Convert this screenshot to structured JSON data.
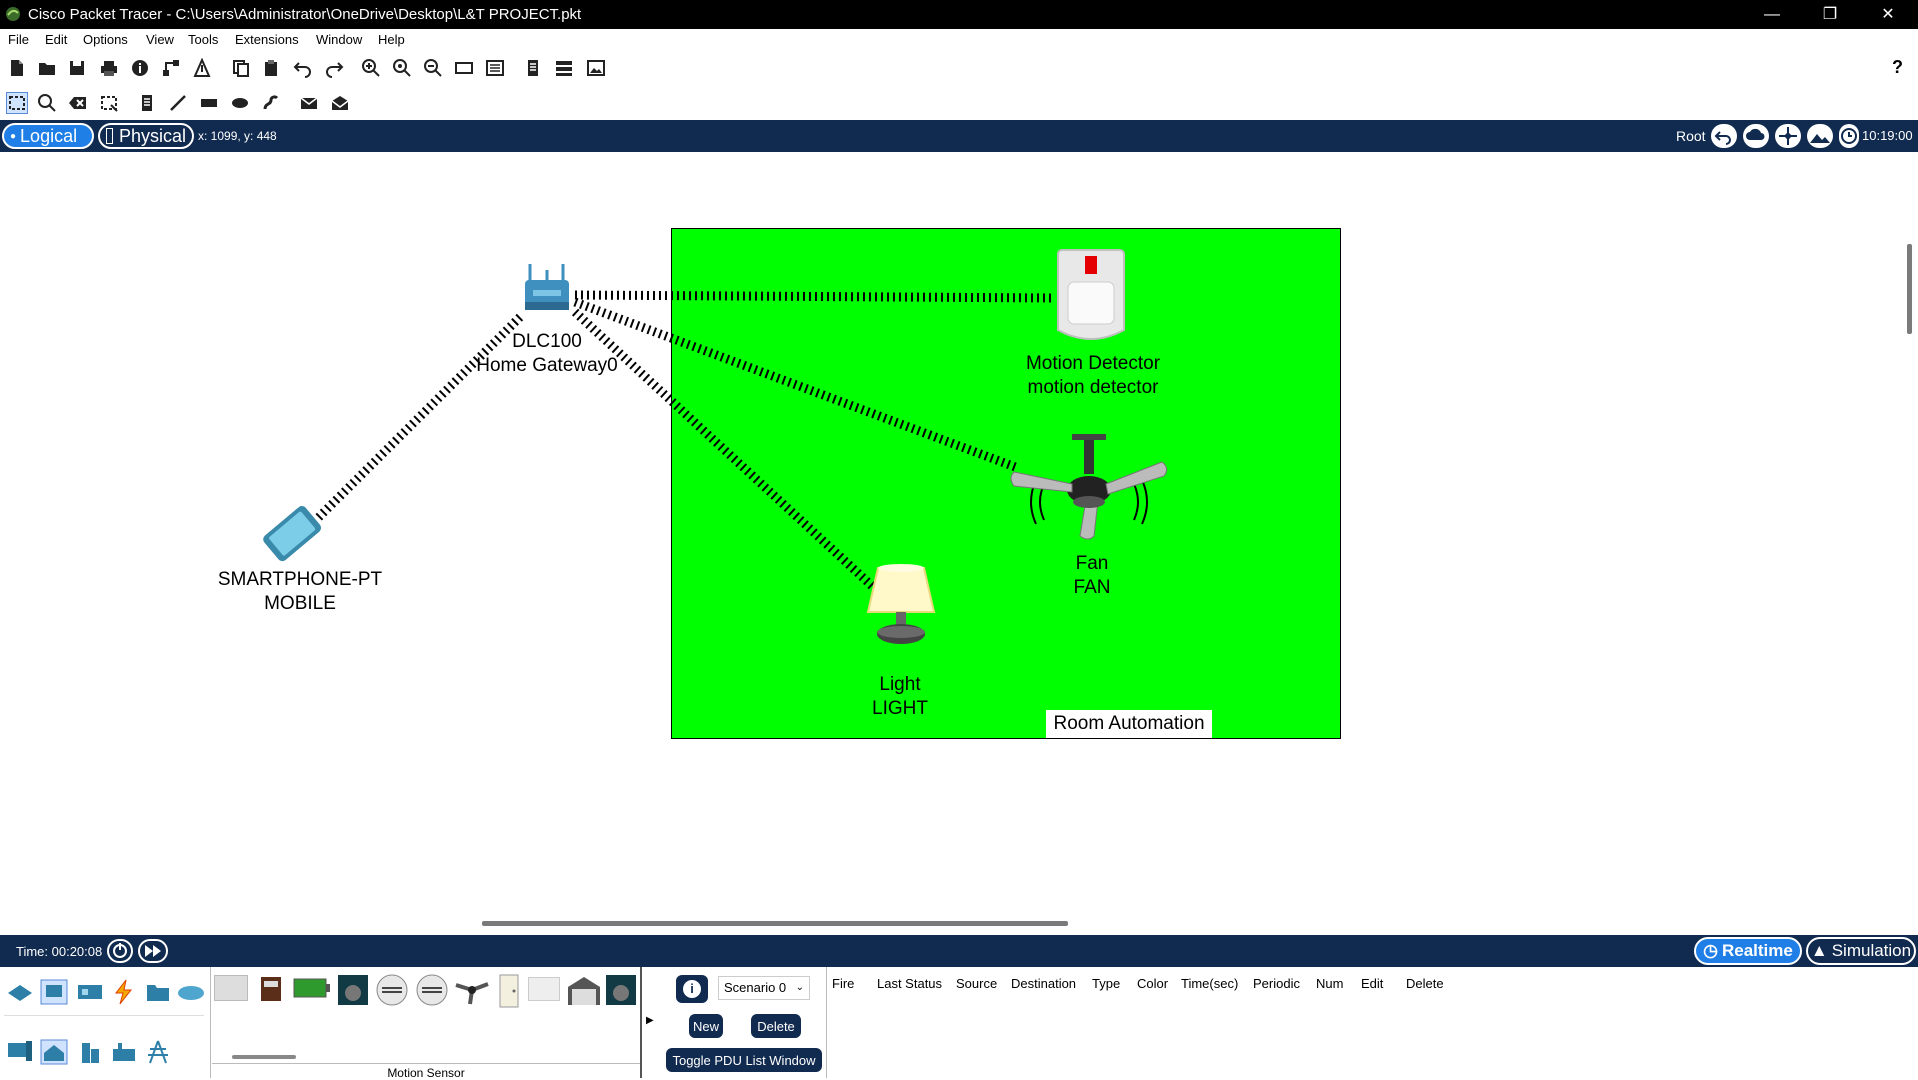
{
  "window": {
    "title": "Cisco Packet Tracer - C:\\Users\\Administrator\\OneDrive\\Desktop\\L&T PROJECT.pkt"
  },
  "menu": [
    "File",
    "Edit",
    "Options",
    "View",
    "Tools",
    "Extensions",
    "Window",
    "Help"
  ],
  "toolbar1_icons": [
    "new-file-icon",
    "open-folder-icon",
    "save-icon",
    "print-icon",
    "info-icon",
    "network-wizard-icon",
    "activity-wizard-icon",
    "copy-icon",
    "paste-icon",
    "undo-icon",
    "redo-icon",
    "zoom-in-icon",
    "zoom-reset-icon",
    "zoom-out-icon",
    "drawing-palette-icon",
    "custom-devices-icon",
    "pdu-list-icon",
    "cluster-icon",
    "image-icon"
  ],
  "toolbar2_icons": [
    "select-icon",
    "inspect-icon",
    "delete-icon",
    "resize-icon",
    "place-note-icon",
    "draw-line-icon",
    "draw-rectangle-icon",
    "draw-ellipse-icon",
    "freeform-icon",
    "add-simple-pdu-icon",
    "add-complex-pdu-icon"
  ],
  "modebar": {
    "logical": "Logical",
    "physical": "Physical",
    "coords": "x: 1099, y: 448",
    "root": "Root",
    "clock": "10:19:00"
  },
  "devices": {
    "gateway": {
      "line1": "DLC100",
      "line2": "Home Gateway0"
    },
    "phone": {
      "line1": "SMARTPHONE-PT",
      "line2": "MOBILE"
    },
    "motion": {
      "line1": "Motion Detector",
      "line2": "motion detector"
    },
    "fan": {
      "line1": "Fan",
      "line2": "FAN"
    },
    "light": {
      "line1": "Light",
      "line2": "LIGHT"
    }
  },
  "room": {
    "label": "Room Automation",
    "color": "#00ff00"
  },
  "timebar": {
    "time": "Time: 00:20:08",
    "realtime": "Realtime",
    "simulation": "Simulation"
  },
  "palette": {
    "selected_label": "Motion Sensor"
  },
  "scenario": {
    "selected": "Scenario 0",
    "new_label": "New",
    "delete_label": "Delete",
    "toggle_label": "Toggle PDU List Window"
  },
  "pdu_columns": [
    "Fire",
    "Last Status",
    "Source",
    "Destination",
    "Type",
    "Color",
    "Time(sec)",
    "Periodic",
    "Num",
    "Edit",
    "Delete"
  ],
  "colors": {
    "navy": "#112a4f",
    "accent": "#1e90ff"
  }
}
